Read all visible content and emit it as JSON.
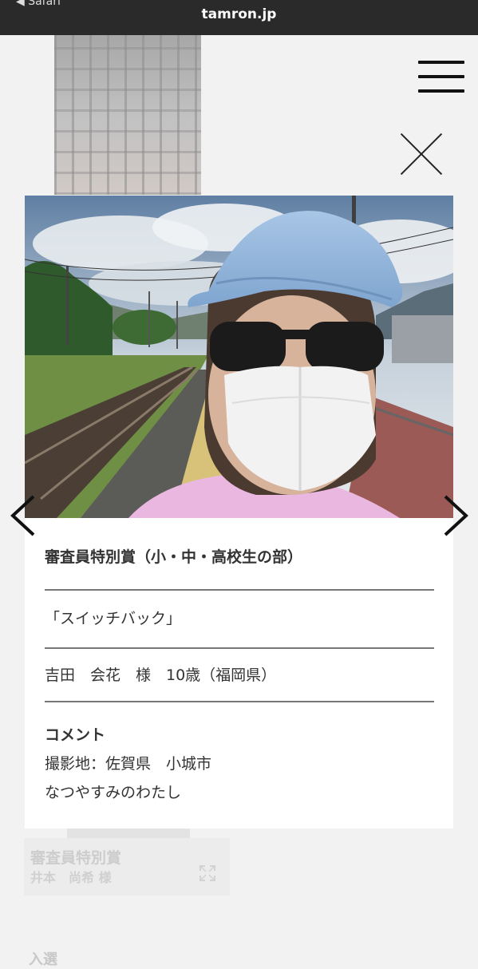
{
  "browser": {
    "back_label": "◀ Safari",
    "url": "tamron.jp"
  },
  "header": {
    "menu_icon": "hamburger-icon",
    "close_icon": "close-icon"
  },
  "modal": {
    "award": "審査員特別賞（小・中・高校生の部）",
    "work_title": "「スイッチバック」",
    "author": "吉田　会花　様　10歳（福岡県）",
    "comment_heading": "コメント",
    "comment_lines": [
      "撮影地：佐賀県　小城市",
      "なつやすみのわたし"
    ]
  },
  "background_list": {
    "award": "審査員特別賞",
    "name": "井本　尚希 様",
    "section_title": "入選"
  },
  "colors": {
    "topbar": "#2a2a2a",
    "page_bg": "#f2f2f2",
    "card_bg": "#ffffff"
  }
}
